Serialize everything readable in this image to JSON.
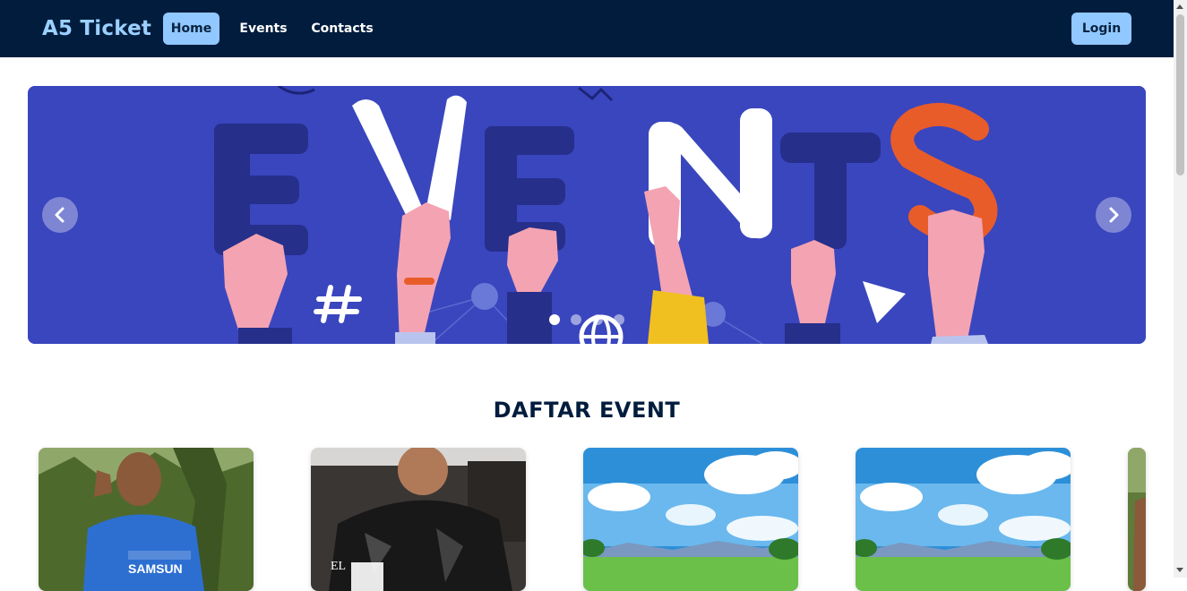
{
  "navbar": {
    "brand": "A5 Ticket",
    "links": [
      {
        "label": "Home",
        "active": true
      },
      {
        "label": "Events",
        "active": false
      },
      {
        "label": "Contacts",
        "active": false
      }
    ],
    "login_label": "Login"
  },
  "hero": {
    "banner_text": [
      "E",
      "V",
      "E",
      "N",
      "T",
      "S"
    ],
    "prev_icon": "chevron-left-icon",
    "next_icon": "chevron-right-icon",
    "slide_count": 4,
    "active_slide": 1
  },
  "section": {
    "title": "DAFTAR EVENT"
  },
  "events": [
    {
      "image": "man-blue-samsung-shirt-photo",
      "poster_text": "SAMSUN"
    },
    {
      "image": "man-batik-shirt-poster",
      "poster_text": "EL"
    },
    {
      "image": "anime-sky-landscape"
    },
    {
      "image": "anime-sky-landscape"
    },
    {
      "image": "man-outdoor-photo-partial"
    }
  ],
  "colors": {
    "navbar_bg": "#011c3d",
    "accent": "#90c8ff",
    "hero_bg": "#3a46be",
    "title": "#011c3d"
  }
}
